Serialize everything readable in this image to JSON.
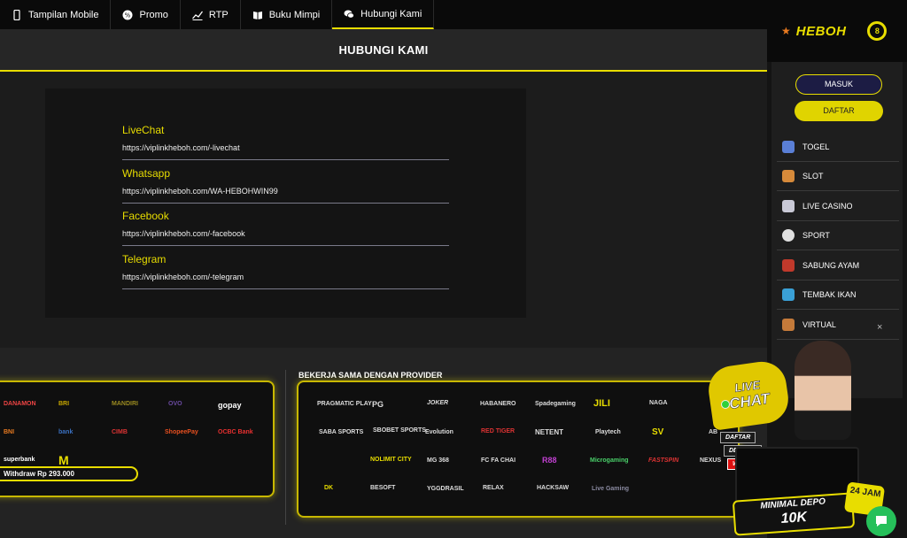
{
  "nav": {
    "tabs": [
      {
        "label": "Tampilan Mobile",
        "icon": "mobile-icon"
      },
      {
        "label": "Promo",
        "icon": "percent-icon"
      },
      {
        "label": "RTP",
        "icon": "chart-icon"
      },
      {
        "label": "Buku Mimpi",
        "icon": "book-icon"
      },
      {
        "label": "Hubungi Kami",
        "icon": "chat-icon",
        "active": true
      }
    ]
  },
  "page": {
    "title": "HUBUNGI KAMI"
  },
  "contacts": [
    {
      "label": "LiveChat",
      "url": "https://viplinkheboh.com/-livechat"
    },
    {
      "label": "Whatsapp",
      "url": "https://viplinkheboh.com/WA-HEBOHWIN99"
    },
    {
      "label": "Facebook",
      "url": "https://viplinkheboh.com/-facebook"
    },
    {
      "label": "Telegram",
      "url": "https://viplinkheboh.com/-telegram"
    }
  ],
  "payments": {
    "logos": [
      "DANAMON",
      "BRI",
      "MANDIRI",
      "OVO",
      "gopay",
      "BNI",
      "bank",
      "CIMB",
      "ShopeePay",
      "OCBC Bank",
      "superbank",
      "M"
    ],
    "withdraw_text": "Withdraw Rp 293.000"
  },
  "providers": {
    "title": "BEKERJA SAMA DENGAN PROVIDER",
    "logos": [
      "PRAGMATIC PLAY",
      "PG",
      "JOKER",
      "HABANERO",
      "Spadegaming",
      "JILI",
      "NAGA",
      "SABA SPORTS",
      "SBOBET SPORTS",
      "Evolution",
      "RED TIGER",
      "NETENT",
      "Playtech",
      "SV",
      "AB",
      "NOLIMIT CITY",
      "MG 368",
      "FC FA CHAI",
      "R88",
      "Microgaming",
      "FASTSPIN",
      "NEXUS",
      "DK",
      "BESOFT",
      "YGGDRASIL",
      "RELAX",
      "HACKSAW",
      "Live Gaming"
    ]
  },
  "sidebar": {
    "brand": "HEBOH",
    "badge": "8",
    "login_label": "MASUK",
    "register_label": "DAFTAR",
    "menu": [
      {
        "label": "TOGEL",
        "color": "#5a7fd6"
      },
      {
        "label": "SLOT",
        "color": "#d68a3a"
      },
      {
        "label": "LIVE CASINO",
        "color": "#c9c9d6"
      },
      {
        "label": "SPORT",
        "color": "#e0e0e0"
      },
      {
        "label": "SABUNG AYAM",
        "color": "#c0392b"
      },
      {
        "label": "TEMBAK IKAN",
        "color": "#3aa0d6"
      },
      {
        "label": "VIRTUAL",
        "color": "#c47a3a"
      }
    ],
    "close_glyph": "×"
  },
  "livechat_widget": {
    "line1": "LIVE",
    "line2": "CHAT",
    "tags": [
      "DAFTAR",
      "DEPOSIT",
      "WITHDRAW"
    ],
    "ribbon_top": "MINIMAL DEPO",
    "ribbon_amount": "10K",
    "badge_24": "24 JAM"
  }
}
